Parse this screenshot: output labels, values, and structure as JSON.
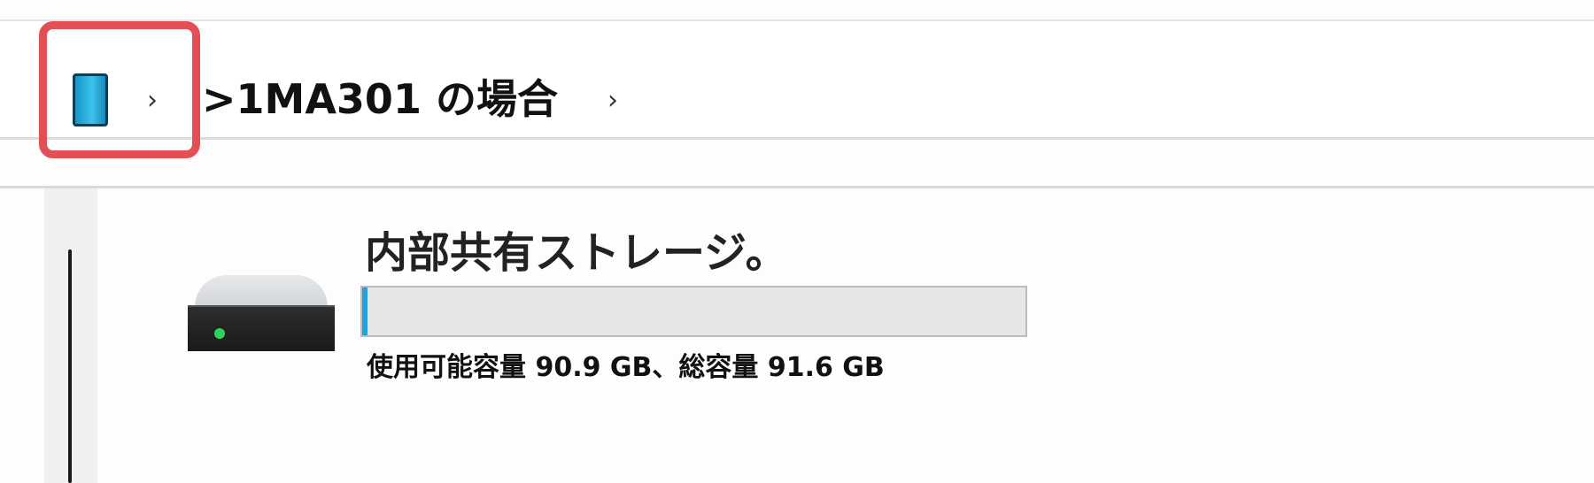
{
  "breadcrumb": {
    "device_icon": "phone-icon",
    "separator_icon": "chevron-right-icon",
    "separator": "›",
    "location": ">1MA301 の場合"
  },
  "drive": {
    "icon": "hard-drive-icon",
    "name": "内部共有ストレージ。",
    "capacity_text": "使用可能容量 90.9 GB、総容量 91.6 GB",
    "free_gb": 90.9,
    "total_gb": 91.6,
    "used_fraction": 0.008,
    "bar_color": "#26a0da"
  },
  "colors": {
    "highlight": "#e25055"
  }
}
